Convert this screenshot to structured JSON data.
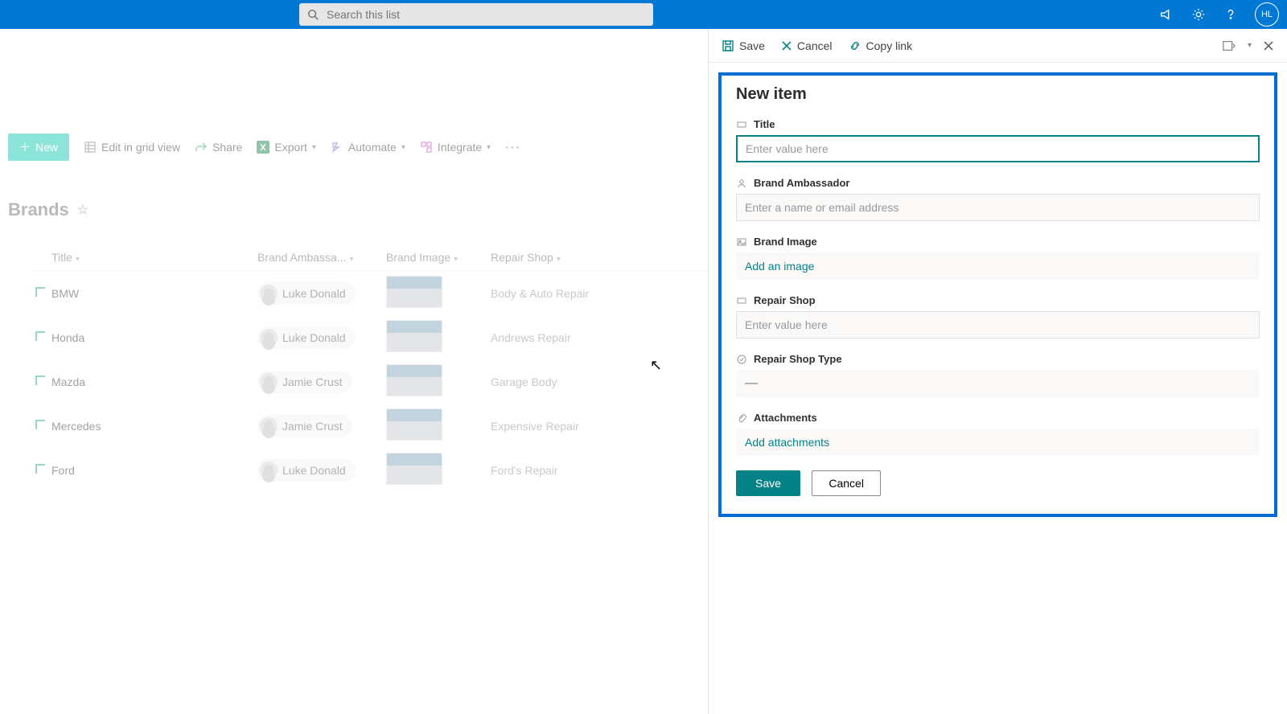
{
  "topbar": {
    "search_placeholder": "Search this list",
    "user_initials": "HL"
  },
  "cmdbar": {
    "new_btn": "New",
    "edit_grid": "Edit in grid view",
    "share": "Share",
    "export": "Export",
    "automate": "Automate",
    "integrate": "Integrate"
  },
  "list": {
    "title": "Brands",
    "columns": {
      "title": "Title",
      "ambassador": "Brand Ambassa...",
      "image": "Brand Image",
      "shop": "Repair Shop"
    },
    "rows": [
      {
        "title": "BMW",
        "ambassador": "Luke Donald",
        "shop": "Body & Auto Repair"
      },
      {
        "title": "Honda",
        "ambassador": "Luke Donald",
        "shop": "Andrews Repair"
      },
      {
        "title": "Mazda",
        "ambassador": "Jamie Crust",
        "shop": "Garage Body"
      },
      {
        "title": "Mercedes",
        "ambassador": "Jamie Crust",
        "shop": "Expensive Repair"
      },
      {
        "title": "Ford",
        "ambassador": "Luke Donald",
        "shop": "Ford's Repair"
      }
    ]
  },
  "panel": {
    "cmd": {
      "save": "Save",
      "cancel": "Cancel",
      "copy": "Copy link"
    },
    "heading": "New item",
    "fields": {
      "title_label": "Title",
      "title_placeholder": "Enter value here",
      "amb_label": "Brand Ambassador",
      "amb_placeholder": "Enter a name or email address",
      "img_label": "Brand Image",
      "img_action": "Add an image",
      "shop_label": "Repair Shop",
      "shop_placeholder": "Enter value here",
      "type_label": "Repair Shop Type",
      "type_value": "—",
      "attach_label": "Attachments",
      "attach_action": "Add attachments"
    },
    "buttons": {
      "save": "Save",
      "cancel": "Cancel"
    }
  }
}
